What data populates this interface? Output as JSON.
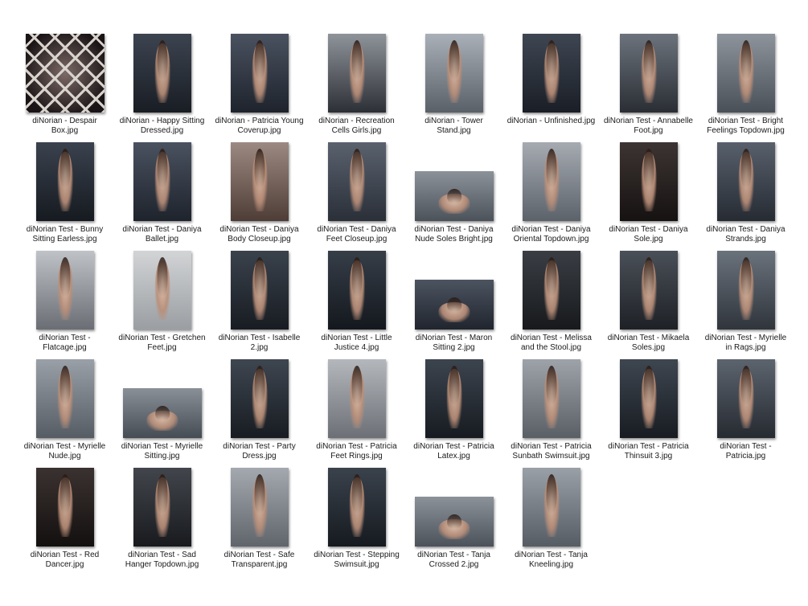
{
  "files": [
    {
      "name": "diNorian - Despair\nBox.jpg",
      "thumb": "despair-box",
      "tone": [
        "#7c6a66",
        "#1a1416"
      ]
    },
    {
      "name": "diNorian - Happy Sitting\nDressed.jpg",
      "thumb": "portrait",
      "tone": [
        "#3c4450",
        "#191d24"
      ]
    },
    {
      "name": "diNorian - Patricia Young\nCoverup.jpg",
      "thumb": "portrait",
      "tone": [
        "#4a5260",
        "#1e232c"
      ]
    },
    {
      "name": "diNorian - Recreation\nCells Girls.jpg",
      "thumb": "portrait",
      "tone": [
        "#8f939a",
        "#2c2f36"
      ]
    },
    {
      "name": "diNorian - Tower\nStand.jpg",
      "thumb": "portrait",
      "tone": [
        "#aab0b8",
        "#5a6068"
      ]
    },
    {
      "name": "diNorian - Unfinished.jpg",
      "thumb": "portrait",
      "tone": [
        "#3e4652",
        "#1a1e26"
      ]
    },
    {
      "name": "diNorian Test - Annabelle\nFoot.jpg",
      "thumb": "portrait",
      "tone": [
        "#6c737c",
        "#2a2e34"
      ]
    },
    {
      "name": "diNorian Test - Bright\nFeelings Topdown.jpg",
      "thumb": "portrait",
      "tone": [
        "#8e949c",
        "#4a5058"
      ]
    },
    {
      "name": "diNorian Test - Bunny\nSitting Earless.jpg",
      "thumb": "portrait",
      "tone": [
        "#3a424e",
        "#161a20"
      ]
    },
    {
      "name": "diNorian Test - Daniya\nBallet.jpg",
      "thumb": "portrait",
      "tone": [
        "#4a5260",
        "#1e232c"
      ]
    },
    {
      "name": "diNorian Test - Daniya\nBody Closeup.jpg",
      "thumb": "portrait",
      "tone": [
        "#9c8a82",
        "#4e3c36"
      ]
    },
    {
      "name": "diNorian Test - Daniya\nFeet Closeup.jpg",
      "thumb": "portrait",
      "tone": [
        "#5a626e",
        "#2a2f38"
      ]
    },
    {
      "name": "diNorian Test - Daniya\nNude Soles Bright.jpg",
      "thumb": "landscape",
      "tone": [
        "#8c9299",
        "#4c525a"
      ]
    },
    {
      "name": "diNorian Test - Daniya\nOriental Topdown.jpg",
      "thumb": "portrait",
      "tone": [
        "#a6abb2",
        "#5c626a"
      ]
    },
    {
      "name": "diNorian Test - Daniya\nSole.jpg",
      "thumb": "portrait",
      "tone": [
        "#3c3432",
        "#161212"
      ]
    },
    {
      "name": "diNorian Test - Daniya\nStrands.jpg",
      "thumb": "portrait",
      "tone": [
        "#58606c",
        "#262b33"
      ]
    },
    {
      "name": "diNorian Test -\nFlatcage.jpg",
      "thumb": "portrait",
      "tone": [
        "#bfc3c8",
        "#6a6e74"
      ]
    },
    {
      "name": "diNorian Test - Gretchen\nFeet.jpg",
      "thumb": "portrait",
      "tone": [
        "#d2d4d6",
        "#9a9ea2"
      ]
    },
    {
      "name": "diNorian Test - Isabelle\n2.jpg",
      "thumb": "portrait",
      "tone": [
        "#3a424c",
        "#181c22"
      ]
    },
    {
      "name": "diNorian Test - Little\nJustice 4.jpg",
      "thumb": "portrait",
      "tone": [
        "#363e48",
        "#14181e"
      ]
    },
    {
      "name": "diNorian Test - Maron\nSitting 2.jpg",
      "thumb": "landscape",
      "tone": [
        "#4c5460",
        "#20252e"
      ]
    },
    {
      "name": "diNorian Test - Melissa\nand the Stool.jpg",
      "thumb": "portrait",
      "tone": [
        "#3a3e44",
        "#17191c"
      ]
    },
    {
      "name": "diNorian Test - Mikaela\nSoles.jpg",
      "thumb": "portrait",
      "tone": [
        "#4a5058",
        "#1e2126"
      ]
    },
    {
      "name": "diNorian Test - Myrielle\nin Rags.jpg",
      "thumb": "portrait",
      "tone": [
        "#6a727c",
        "#30353c"
      ]
    },
    {
      "name": "diNorian Test - Myrielle\nNude.jpg",
      "thumb": "portrait",
      "tone": [
        "#9aa0a8",
        "#565c64"
      ]
    },
    {
      "name": "diNorian Test - Myrielle\nSitting.jpg",
      "thumb": "landscape",
      "tone": [
        "#8a9098",
        "#464c54"
      ]
    },
    {
      "name": "diNorian Test - Party\nDress.jpg",
      "thumb": "portrait",
      "tone": [
        "#3e4650",
        "#181c22"
      ]
    },
    {
      "name": "diNorian Test - Patricia\nFeet Rings.jpg",
      "thumb": "portrait",
      "tone": [
        "#b4b8bd",
        "#6c7076"
      ]
    },
    {
      "name": "diNorian Test - Patricia\nLatex.jpg",
      "thumb": "portrait",
      "tone": [
        "#3c444e",
        "#171b21"
      ]
    },
    {
      "name": "diNorian Test - Patricia\nSunbath Swimsuit.jpg",
      "thumb": "portrait",
      "tone": [
        "#9ea3aa",
        "#5a5f66"
      ]
    },
    {
      "name": "diNorian Test - Patricia\nThinsuit 3.jpg",
      "thumb": "portrait",
      "tone": [
        "#3e4650",
        "#181c22"
      ]
    },
    {
      "name": "diNorian Test -\nPatricia.jpg",
      "thumb": "portrait",
      "tone": [
        "#5c646e",
        "#262a31"
      ]
    },
    {
      "name": "diNorian Test - Red\nDancer.jpg",
      "thumb": "portrait",
      "tone": [
        "#3a3230",
        "#141010"
      ]
    },
    {
      "name": "diNorian Test - Sad\nHanger Topdown.jpg",
      "thumb": "portrait",
      "tone": [
        "#42464c",
        "#181a1e"
      ]
    },
    {
      "name": "diNorian Test - Safe\nTransparent.jpg",
      "thumb": "portrait",
      "tone": [
        "#a4a9b0",
        "#60656c"
      ]
    },
    {
      "name": "diNorian Test - Stepping\nSwimsuit.jpg",
      "thumb": "portrait",
      "tone": [
        "#3a424c",
        "#161a20"
      ]
    },
    {
      "name": "diNorian Test - Tanja\nCrossed 2.jpg",
      "thumb": "landscape",
      "tone": [
        "#8c9299",
        "#4c525a"
      ]
    },
    {
      "name": "diNorian Test - Tanja\nKneeling.jpg",
      "thumb": "portrait",
      "tone": [
        "#9aa0a8",
        "#565c64"
      ]
    }
  ]
}
